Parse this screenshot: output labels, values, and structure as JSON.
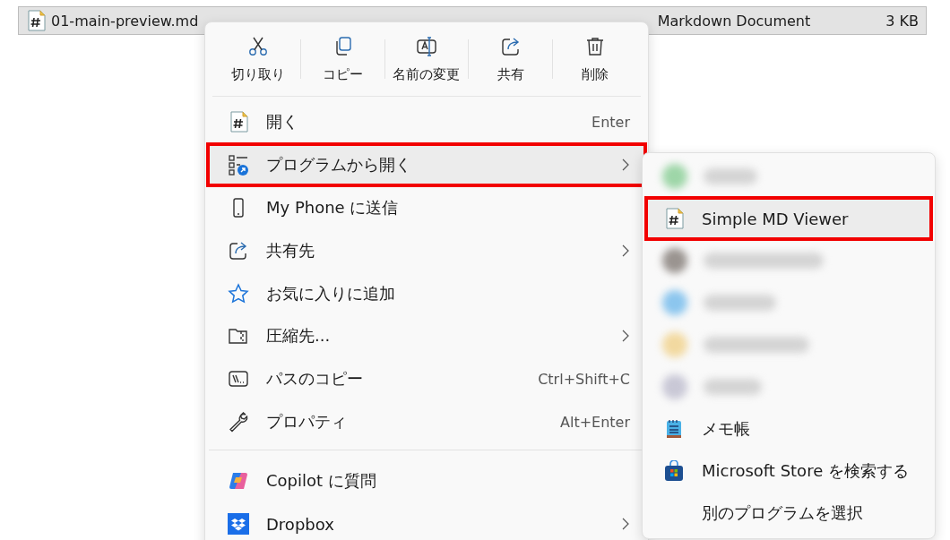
{
  "file_row": {
    "name": "01-main-preview.md",
    "type": "Markdown Document",
    "size": "3 KB"
  },
  "context_menu": {
    "toolbar": [
      {
        "kind": "cut",
        "label": "切り取り"
      },
      {
        "kind": "copy",
        "label": "コピー"
      },
      {
        "kind": "rename",
        "label": "名前の変更"
      },
      {
        "kind": "share",
        "label": "共有"
      },
      {
        "kind": "delete",
        "label": "削除"
      }
    ],
    "items": [
      {
        "kind": "md",
        "label": "開く",
        "shortcut": "Enter",
        "submenu": false,
        "selected": false,
        "highlighted": false
      },
      {
        "kind": "openwith",
        "label": "プログラムから開く",
        "submenu": true,
        "selected": true,
        "highlighted": true
      },
      {
        "kind": "phone",
        "label": "My Phone に送信",
        "submenu": false,
        "selected": false,
        "highlighted": false
      },
      {
        "kind": "share",
        "label": "共有先",
        "submenu": true,
        "selected": false,
        "highlighted": false
      },
      {
        "kind": "star",
        "label": "お気に入りに追加",
        "submenu": false,
        "selected": false,
        "highlighted": false
      },
      {
        "kind": "zip",
        "label": "圧縮先...",
        "submenu": true,
        "selected": false,
        "highlighted": false
      },
      {
        "kind": "path",
        "label": "パスのコピー",
        "shortcut": "Ctrl+Shift+C",
        "submenu": false,
        "selected": false,
        "highlighted": false
      },
      {
        "kind": "wrench",
        "label": "プロパティ",
        "shortcut": "Alt+Enter",
        "submenu": false,
        "selected": false,
        "highlighted": false
      },
      {
        "kind": "separator"
      },
      {
        "kind": "copilot",
        "label": "Copilot に質問",
        "submenu": false,
        "selected": false,
        "highlighted": false
      },
      {
        "kind": "dropbox",
        "label": "Dropbox",
        "submenu": true,
        "selected": false,
        "highlighted": false
      }
    ]
  },
  "submenu": {
    "items": [
      {
        "kind": "blurred",
        "color": "#9ed6a8"
      },
      {
        "kind": "md",
        "label": "Simple MD Viewer",
        "selected": true,
        "highlighted": true
      },
      {
        "kind": "blurred",
        "color": "#9a9490"
      },
      {
        "kind": "blurred",
        "color": "#8cc6ee"
      },
      {
        "kind": "blurred",
        "color": "#f2d9a0"
      },
      {
        "kind": "blurred",
        "color": "#c9c8d6"
      },
      {
        "kind": "notepad",
        "label": "メモ帳",
        "selected": false,
        "highlighted": false
      },
      {
        "kind": "store",
        "label": "Microsoft Store を検索する",
        "selected": false,
        "highlighted": false
      },
      {
        "kind": "none",
        "label": "別のプログラムを選択",
        "selected": false,
        "highlighted": false
      }
    ]
  }
}
